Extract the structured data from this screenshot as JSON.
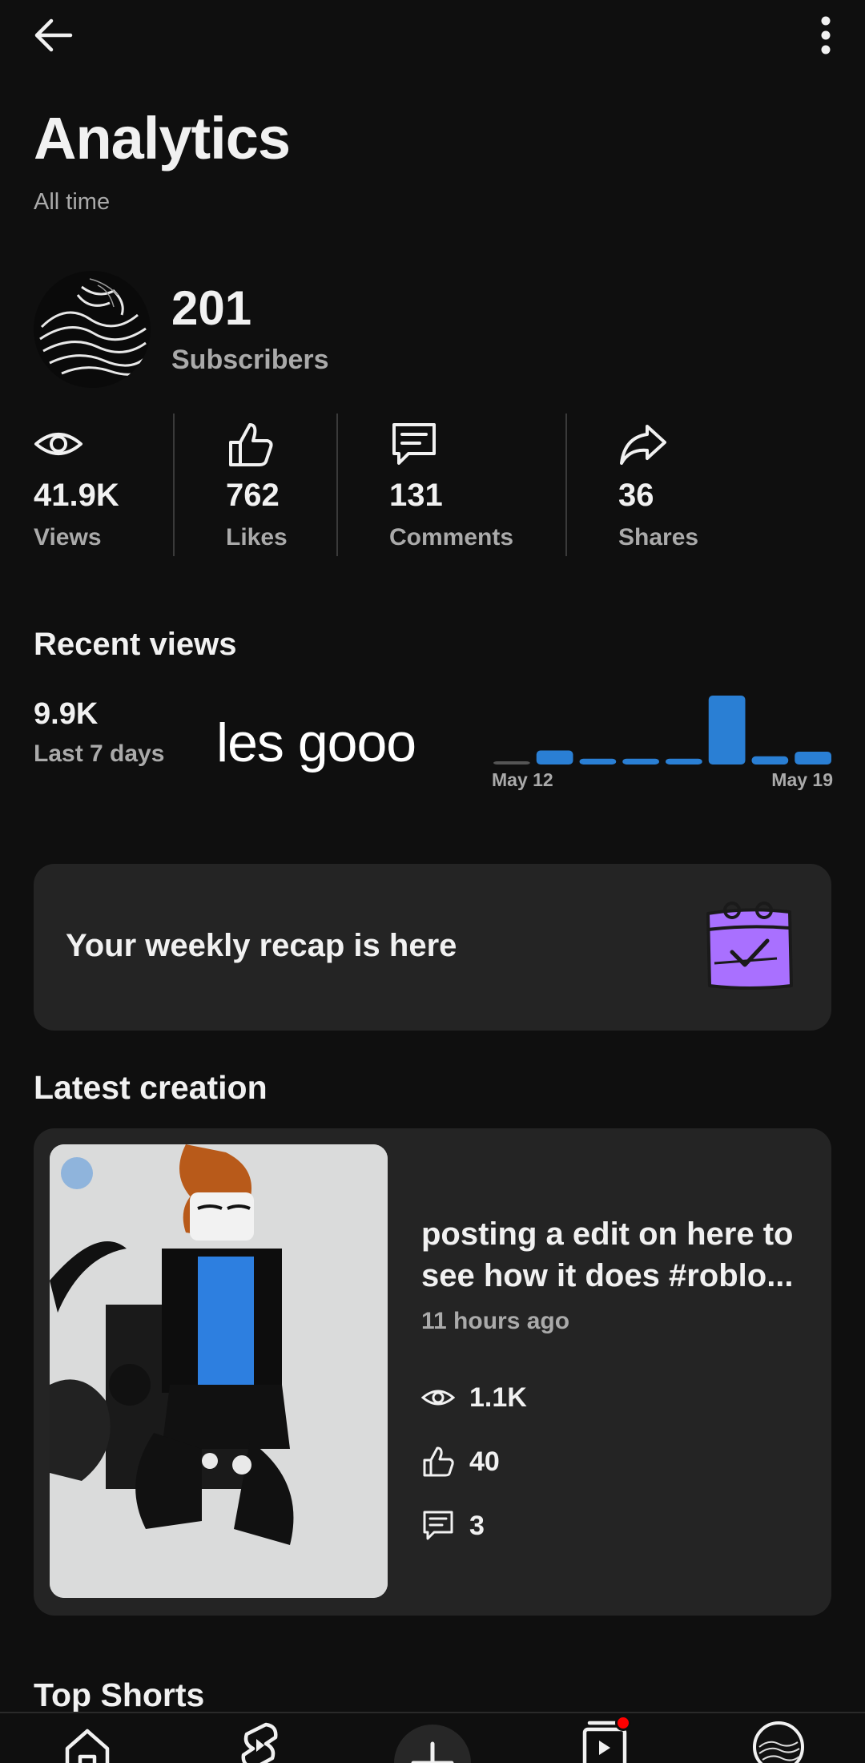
{
  "header": {
    "title": "Analytics",
    "subtitle": "All time"
  },
  "channel": {
    "subscribers_count": "201",
    "subscribers_label": "Subscribers"
  },
  "stats": [
    {
      "value": "41.9K",
      "label": "Views",
      "icon": "eye-icon"
    },
    {
      "value": "762",
      "label": "Likes",
      "icon": "thumbs-up-icon"
    },
    {
      "value": "131",
      "label": "Comments",
      "icon": "comment-icon"
    },
    {
      "value": "36",
      "label": "Shares",
      "icon": "share-icon"
    }
  ],
  "recent_views": {
    "title": "Recent views",
    "value": "9.9K",
    "period": "Last 7 days",
    "overlay_text": "les gooo",
    "chart_start_label": "May 12",
    "chart_end_label": "May 19"
  },
  "chart_data": {
    "type": "bar",
    "categories": [
      "",
      "",
      "",
      "",
      "",
      "",
      "",
      ""
    ],
    "values": [
      0.1,
      1.2,
      0.5,
      0.5,
      0.5,
      5.9,
      0.7,
      1.1
    ],
    "xlabel": "",
    "ylabel": "",
    "color": "#2a7fd4"
  },
  "recap": {
    "text": "Your weekly recap is here",
    "icon": "calendar-check-icon",
    "accent": "#a970ff"
  },
  "latest": {
    "section_title": "Latest creation",
    "video_title": "posting a edit on here to see how it does #roblo...",
    "time": "11 hours ago",
    "views": "1.1K",
    "likes": "40",
    "comments": "3"
  },
  "top_shorts": {
    "title": "Top Shorts"
  },
  "nav": {
    "items": [
      "home-icon",
      "shorts-icon",
      "create-icon",
      "subscriptions-icon",
      "profile-avatar"
    ],
    "notification_color": "#ff0000"
  }
}
